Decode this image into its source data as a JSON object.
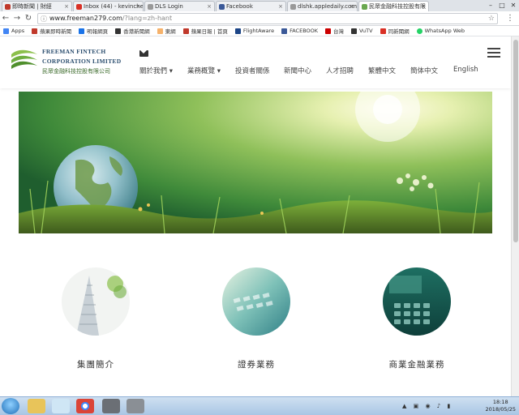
{
  "browser": {
    "tabs": [
      {
        "title": "即時新聞 | 財經",
        "fav_color": "#c0392b",
        "active": false
      },
      {
        "title": "Inbox (44) - kevinche...",
        "fav_color": "#d93025",
        "active": false
      },
      {
        "title": "DLS Login",
        "fav_color": "#999999",
        "active": false
      },
      {
        "title": "Facebook",
        "fav_color": "#3b5998",
        "active": false
      },
      {
        "title": "dlshk.appledaily.com",
        "fav_color": "#999999",
        "active": false
      },
      {
        "title": "民眾金融科技控股有限",
        "fav_color": "#6aa84f",
        "active": true
      }
    ],
    "url_host": "www.freeman279.com",
    "url_path": "/?lang=zh-hant",
    "bookmarks": [
      {
        "label": "Apps",
        "color": "#4285f4"
      },
      {
        "label": "蘋果即時新聞",
        "color": "#c0392b"
      },
      {
        "label": "明報網頁",
        "color": "#1a73e8"
      },
      {
        "label": "香港新聞網",
        "color": "#333333"
      },
      {
        "label": "東網",
        "color": "#f6b26b"
      },
      {
        "label": "蘋果日報 | 首頁",
        "color": "#c0392b"
      },
      {
        "label": "FlightAware",
        "color": "#1c4587"
      },
      {
        "label": "FACEBOOK",
        "color": "#3b5998"
      },
      {
        "label": "台灣",
        "color": "#cc0000"
      },
      {
        "label": "VuTV",
        "color": "#333333"
      },
      {
        "label": "同新聞網",
        "color": "#d93025"
      },
      {
        "label": "WhatsApp Web",
        "color": "#25d366"
      }
    ]
  },
  "site": {
    "logo_line1": "FREEMAN FINTECH",
    "logo_line2": "CORPORATION LIMITED",
    "logo_line3": "民眾金融科技控股有限公司",
    "nav": [
      {
        "label": "關於我們 ▾"
      },
      {
        "label": "業務概覽 ▾"
      },
      {
        "label": "投資者關係"
      },
      {
        "label": "新聞中心"
      },
      {
        "label": "人才招聘"
      },
      {
        "label": "繁體中文"
      },
      {
        "label": "簡体中文"
      },
      {
        "label": "English"
      }
    ],
    "features": [
      {
        "label": "集團簡介"
      },
      {
        "label": "證券業務"
      },
      {
        "label": "商業金融業務"
      }
    ]
  },
  "taskbar": {
    "time": "18:18",
    "date": "2018/05/25"
  },
  "colors": {
    "brand_green": "#6fae3f",
    "brand_blue": "#2a4d6e"
  }
}
